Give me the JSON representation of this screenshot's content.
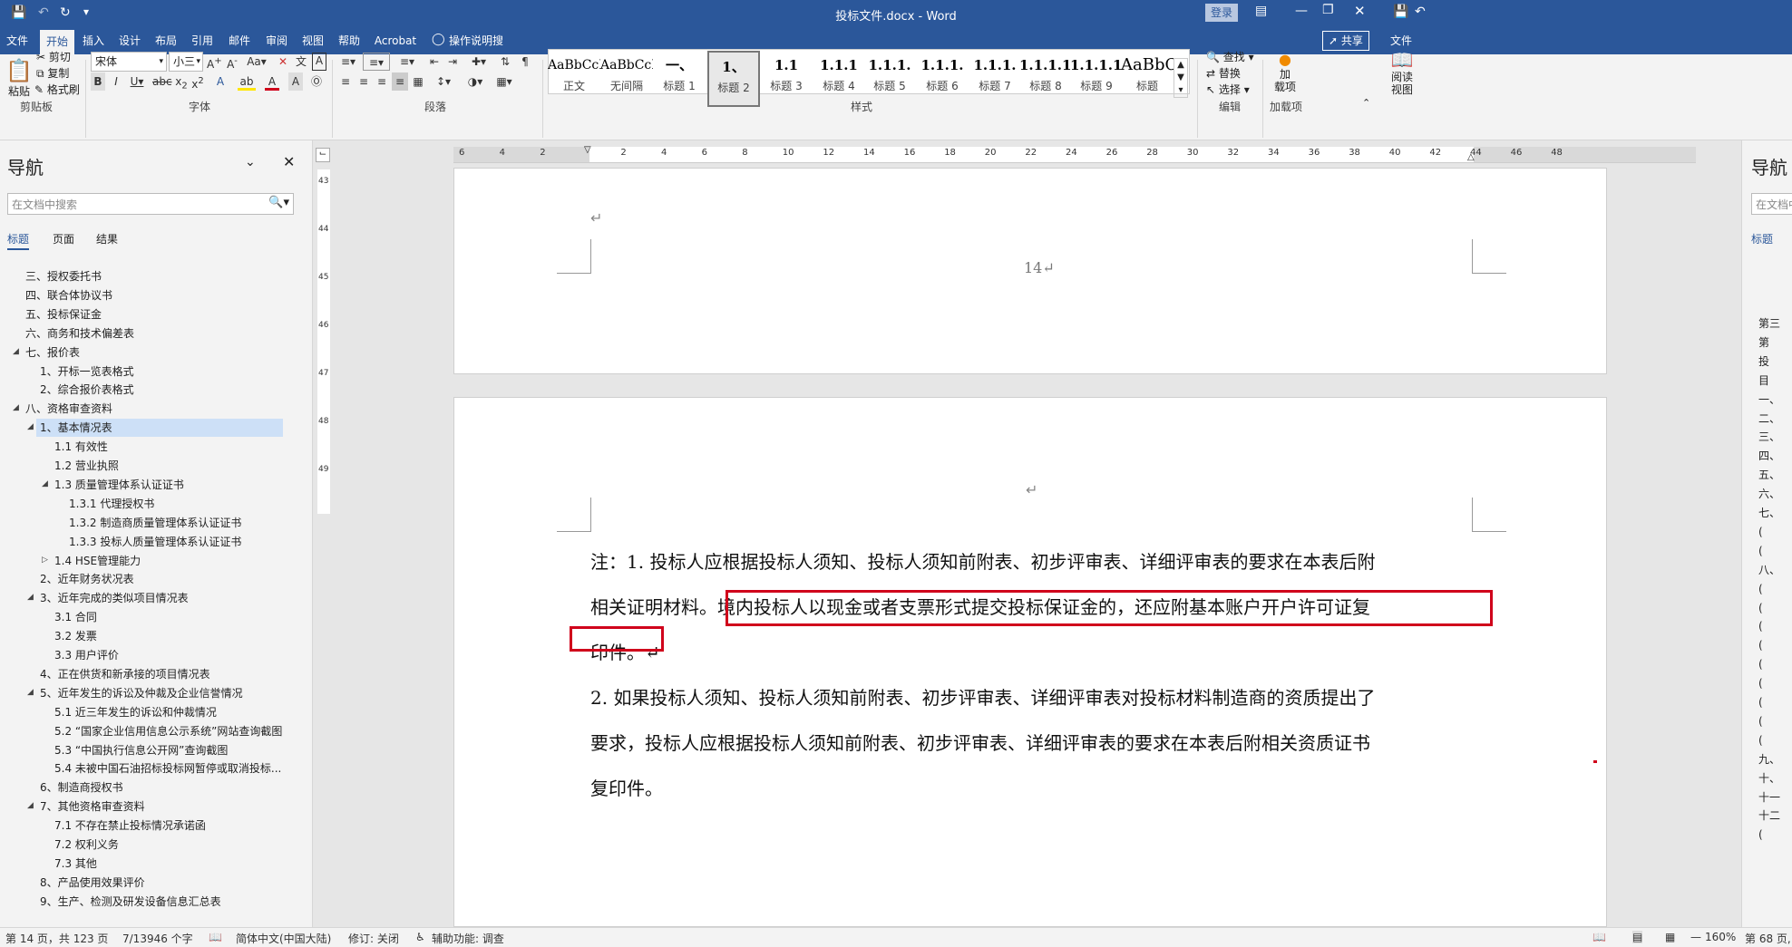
{
  "window": {
    "title": "投标文件.docx  -  Word",
    "login_label": "登录",
    "right_title_icon": "save-icon"
  },
  "tabs": [
    "文件",
    "开始",
    "插入",
    "设计",
    "布局",
    "引用",
    "邮件",
    "审阅",
    "视图",
    "帮助",
    "Acrobat",
    "操作说明搜索"
  ],
  "share_label": "共享",
  "right_file_tab": "文件",
  "ribbon": {
    "clipboard": {
      "paste": "粘贴",
      "cut": "剪切",
      "copy": "复制",
      "format_painter": "格式刷",
      "group": "剪贴板"
    },
    "font": {
      "name": "宋体",
      "size": "小三",
      "group": "字体"
    },
    "paragraph": {
      "group": "段落"
    },
    "styles": {
      "group": "样式",
      "items": [
        {
          "preview": "AaBbCcDdI",
          "name": "正文"
        },
        {
          "preview": "AaBbCcDdI",
          "name": "无间隔"
        },
        {
          "preview": "一、",
          "name": "标题 1"
        },
        {
          "preview": "1、",
          "name": "标题 2"
        },
        {
          "preview": "1.1",
          "name": "标题 3"
        },
        {
          "preview": "1.1.1",
          "name": "标题 4"
        },
        {
          "preview": "1.1.1.",
          "name": "标题 5"
        },
        {
          "preview": "1.1.1.",
          "name": "标题 6"
        },
        {
          "preview": "1.1.1.",
          "name": "标题 7"
        },
        {
          "preview": "1.1.1.1.",
          "name": "标题 8"
        },
        {
          "preview": "1.1.1.1.",
          "name": "标题 9"
        },
        {
          "preview": "AaBbC",
          "name": "标题"
        }
      ]
    },
    "editing": {
      "find": "查找",
      "replace": "替换",
      "select": "选择",
      "group": "编辑"
    },
    "addins": {
      "button": "加\n载项",
      "group": "加载项"
    },
    "reading_view": "阅读\n视图"
  },
  "nav": {
    "title": "导航",
    "search_placeholder": "在文档中搜索",
    "tabs": [
      "标题",
      "页面",
      "结果"
    ],
    "items": [
      {
        "text": "三、授权委托书",
        "level": 1,
        "exp": ""
      },
      {
        "text": "四、联合体协议书",
        "level": 1,
        "exp": ""
      },
      {
        "text": "五、投标保证金",
        "level": 1,
        "exp": ""
      },
      {
        "text": "六、商务和技术偏差表",
        "level": 1,
        "exp": ""
      },
      {
        "text": "七、报价表",
        "level": 1,
        "exp": "open"
      },
      {
        "text": "1、开标一览表格式",
        "level": 2,
        "exp": ""
      },
      {
        "text": "2、综合报价表格式",
        "level": 2,
        "exp": ""
      },
      {
        "text": "八、资格审查资料",
        "level": 1,
        "exp": "open"
      },
      {
        "text": "1、基本情况表",
        "level": 2,
        "exp": "open",
        "selected": true
      },
      {
        "text": "1.1 有效性",
        "level": 3,
        "exp": ""
      },
      {
        "text": "1.2 营业执照",
        "level": 3,
        "exp": ""
      },
      {
        "text": "1.3 质量管理体系认证证书",
        "level": 3,
        "exp": "open"
      },
      {
        "text": "1.3.1 代理授权书",
        "level": 4,
        "exp": ""
      },
      {
        "text": "1.3.2 制造商质量管理体系认证证书",
        "level": 4,
        "exp": ""
      },
      {
        "text": "1.3.3 投标人质量管理体系认证证书",
        "level": 4,
        "exp": ""
      },
      {
        "text": "1.4 HSE管理能力",
        "level": 3,
        "exp": "closed"
      },
      {
        "text": "2、近年财务状况表",
        "level": 2,
        "exp": ""
      },
      {
        "text": "3、近年完成的类似项目情况表",
        "level": 2,
        "exp": "open"
      },
      {
        "text": "3.1 合同",
        "level": 3,
        "exp": ""
      },
      {
        "text": "3.2 发票",
        "level": 3,
        "exp": ""
      },
      {
        "text": "3.3 用户评价",
        "level": 3,
        "exp": ""
      },
      {
        "text": "4、正在供货和新承接的项目情况表",
        "level": 2,
        "exp": ""
      },
      {
        "text": "5、近年发生的诉讼及仲裁及企业信誉情况",
        "level": 2,
        "exp": "open"
      },
      {
        "text": "5.1 近三年发生的诉讼和仲裁情况",
        "level": 3,
        "exp": ""
      },
      {
        "text": "5.2 “国家企业信用信息公示系统”网站查询截图",
        "level": 3,
        "exp": ""
      },
      {
        "text": "5.3 “中国执行信息公开网”查询截图",
        "level": 3,
        "exp": ""
      },
      {
        "text": "5.4 未被中国石油招标投标网暂停或取消投标...",
        "level": 3,
        "exp": ""
      },
      {
        "text": "6、制造商授权书",
        "level": 2,
        "exp": ""
      },
      {
        "text": "7、其他资格审查资料",
        "level": 2,
        "exp": "open"
      },
      {
        "text": "7.1 不存在禁止投标情况承诺函",
        "level": 3,
        "exp": ""
      },
      {
        "text": "7.2 权利义务",
        "level": 3,
        "exp": ""
      },
      {
        "text": "7.3 其他",
        "level": 3,
        "exp": ""
      },
      {
        "text": "8、产品使用效果评价",
        "level": 2,
        "exp": ""
      },
      {
        "text": "9、生产、检测及研发设备信息汇总表",
        "level": 2,
        "exp": ""
      }
    ]
  },
  "ruler": {
    "ticks": [
      "6",
      "4",
      "2",
      "",
      "2",
      "4",
      "6",
      "8",
      "10",
      "12",
      "14",
      "16",
      "18",
      "20",
      "22",
      "24",
      "26",
      "28",
      "30",
      "32",
      "34",
      "36",
      "38",
      "40",
      "42",
      "44",
      "46",
      "48"
    ],
    "vticks": [
      "43",
      "44",
      "45",
      "46",
      "47",
      "48",
      "49"
    ]
  },
  "document": {
    "page_number": "14↵",
    "para_mark": "↵",
    "lines": [
      "注：1. 投标人应根据投标人须知、投标人须知前附表、初步评审表、详细评审表的要求在本表后附",
      "相关证明材料。境内投标人以现金或者支票形式提交投标保证金的，还应附基本账户开户许可证复",
      "印件。↵",
      "2. 如果投标人须知、投标人须知前附表、初步评审表、详细评审表对投标材料制造商的资质提出了",
      "要求，投标人应根据投标人须知前附表、初步评审表、详细评审表的要求在本表后附相关资质证书",
      "复印件。"
    ]
  },
  "right_nav": {
    "title": "导航",
    "search_placeholder": "在文档中",
    "tab": "标题",
    "items": [
      "第三",
      "第",
      "投",
      "目",
      "一、",
      "二、",
      "三、",
      "四、",
      "五、",
      "六、",
      "七、",
      "(",
      "(",
      "八、",
      "(",
      "(",
      "(",
      "(",
      "(",
      "(",
      "(",
      "(",
      "(",
      "九、",
      "十、",
      "十一",
      "十二",
      "("
    ]
  },
  "status": {
    "page": "第 14 页，共 123 页",
    "words": "7/13946 个字",
    "language": "简体中文(中国大陆)",
    "track": "修订: 关闭",
    "accessibility": "辅助功能: 调查",
    "zoom": "160%",
    "right_page": "第 68 页,"
  },
  "colors": {
    "brand": "#2b579a",
    "highlight_box": "#d0021b",
    "selected_nav": "#cde0f7"
  }
}
